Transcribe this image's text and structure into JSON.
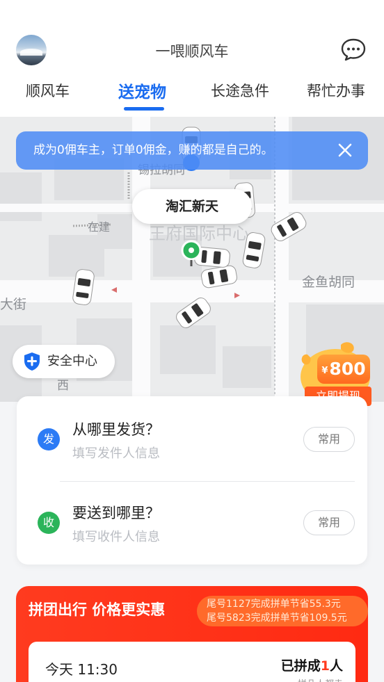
{
  "header": {
    "title": "一喂顺风车"
  },
  "tabs": [
    {
      "label": "顺风车",
      "active": false
    },
    {
      "label": "送宠物",
      "active": true
    },
    {
      "label": "长途急件",
      "active": false
    },
    {
      "label": "帮忙办事",
      "active": false
    }
  ],
  "map": {
    "banner_text": "成为0佣车主，订单0佣金，赚的都是自己的。",
    "place_label": "淘汇新天",
    "street_labels": [
      "锡拉胡同",
      "王府国际中心",
      "金鱼胡同",
      "大街",
      "在建",
      "西"
    ],
    "safety_center": "安全中心",
    "reward": {
      "currency": "¥",
      "amount": "800",
      "cta": "立即提现"
    }
  },
  "address": {
    "from": {
      "badge": "发",
      "title": "从哪里发货？",
      "hint": "填写发件人信息",
      "common": "常用"
    },
    "to": {
      "badge": "收",
      "title": "要送到哪里？",
      "hint": "填写收件人信息",
      "common": "常用"
    }
  },
  "group": {
    "title": "拼团出行 价格更实惠",
    "ticker": [
      "尾号1127完成拼单节省55.3元",
      "尾号5823完成拼单节省109.5元"
    ],
    "trip_time": "今天 11:30",
    "status_prefix": "已拼成",
    "status_count": "1",
    "status_suffix": "人",
    "status_sub": "拼几人都走"
  },
  "colors": {
    "accent": "#1a6cf0",
    "from_badge": "#2c7bf5",
    "to_badge": "#2bb45a",
    "group_red": "#ff3b1f",
    "reward_orange": "#ff6a1f"
  }
}
